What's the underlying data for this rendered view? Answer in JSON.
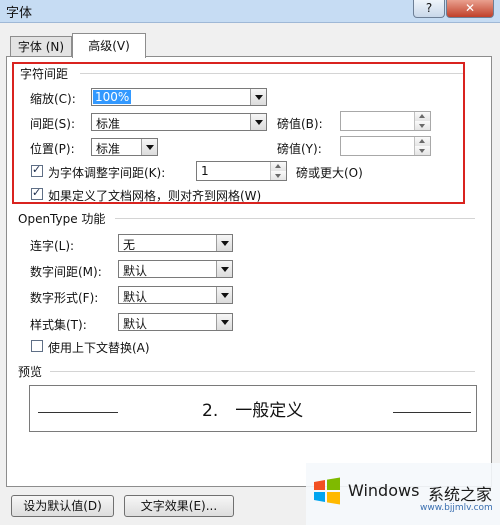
{
  "window": {
    "title": "字体",
    "help_label": "?",
    "close_label": "✕"
  },
  "tabs": [
    {
      "label": "字体 (N)"
    },
    {
      "label": "高级(V)"
    }
  ],
  "char_spacing": {
    "section_title": "字符间距",
    "scale": {
      "label": "缩放(C):",
      "value": "100%"
    },
    "spacing": {
      "label": "间距(S):",
      "value": "标准",
      "pounds_label": "磅值(B):",
      "pounds_value": ""
    },
    "position": {
      "label": "位置(P):",
      "value": "标准",
      "pounds_label": "磅值(Y):",
      "pounds_value": ""
    },
    "kerning": {
      "label": "为字体调整字间距(K):",
      "checked": true,
      "value": "1",
      "suffix": "磅或更大(O)"
    },
    "snap_grid": {
      "label": "如果定义了文档网格，则对齐到网格(W)",
      "checked": true
    }
  },
  "opentype": {
    "section_title": "OpenType 功能",
    "ligatures": {
      "label": "连字(L):",
      "value": "无"
    },
    "number_spacing": {
      "label": "数字间距(M):",
      "value": "默认"
    },
    "number_forms": {
      "label": "数字形式(F):",
      "value": "默认"
    },
    "stylistic_sets": {
      "label": "样式集(T):",
      "value": "默认"
    },
    "contextual_alternates": {
      "label": "使用上下文替换(A)",
      "checked": false
    }
  },
  "preview": {
    "section_title": "预览",
    "sample_text": "2.　一般定义"
  },
  "footer": {
    "set_default_label": "设为默认值(D)",
    "text_effects_label": "文字效果(E)..."
  },
  "watermark": {
    "brand": "Windows",
    "site_cn": "系统之家",
    "domain": "www.bjjmlv.com"
  },
  "colors": {
    "highlight_frame": "#d9231f",
    "selection": "#3399ff",
    "title_bar": "#c6dcf3"
  }
}
